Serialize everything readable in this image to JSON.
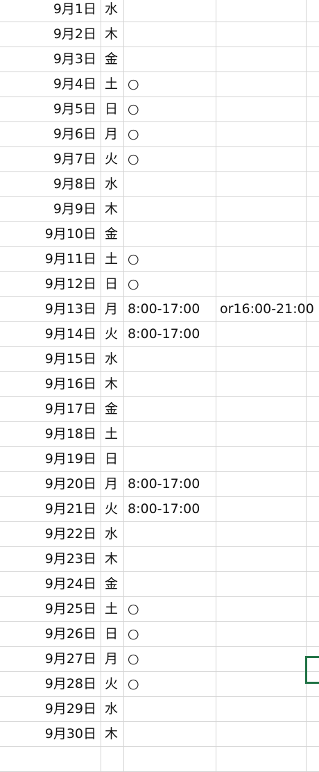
{
  "sheet": {
    "rows": [
      {
        "date": "9月1日",
        "weekday": "水",
        "col_c": "",
        "col_d": ""
      },
      {
        "date": "9月2日",
        "weekday": "木",
        "col_c": "",
        "col_d": ""
      },
      {
        "date": "9月3日",
        "weekday": "金",
        "col_c": "",
        "col_d": ""
      },
      {
        "date": "9月4日",
        "weekday": "土",
        "col_c": "○",
        "col_d": ""
      },
      {
        "date": "9月5日",
        "weekday": "日",
        "col_c": "○",
        "col_d": ""
      },
      {
        "date": "9月6日",
        "weekday": "月",
        "col_c": "○",
        "col_d": ""
      },
      {
        "date": "9月7日",
        "weekday": "火",
        "col_c": "○",
        "col_d": ""
      },
      {
        "date": "9月8日",
        "weekday": "水",
        "col_c": "",
        "col_d": ""
      },
      {
        "date": "9月9日",
        "weekday": "木",
        "col_c": "",
        "col_d": ""
      },
      {
        "date": "9月10日",
        "weekday": "金",
        "col_c": "",
        "col_d": ""
      },
      {
        "date": "9月11日",
        "weekday": "土",
        "col_c": "○",
        "col_d": ""
      },
      {
        "date": "9月12日",
        "weekday": "日",
        "col_c": "○",
        "col_d": ""
      },
      {
        "date": "9月13日",
        "weekday": "月",
        "col_c": "8:00-17:00",
        "col_d": "or16:00-21:00"
      },
      {
        "date": "9月14日",
        "weekday": "火",
        "col_c": "8:00-17:00",
        "col_d": ""
      },
      {
        "date": "9月15日",
        "weekday": "水",
        "col_c": "",
        "col_d": ""
      },
      {
        "date": "9月16日",
        "weekday": "木",
        "col_c": "",
        "col_d": ""
      },
      {
        "date": "9月17日",
        "weekday": "金",
        "col_c": "",
        "col_d": ""
      },
      {
        "date": "9月18日",
        "weekday": "土",
        "col_c": "",
        "col_d": ""
      },
      {
        "date": "9月19日",
        "weekday": "日",
        "col_c": "",
        "col_d": ""
      },
      {
        "date": "9月20日",
        "weekday": "月",
        "col_c": "8:00-17:00",
        "col_d": ""
      },
      {
        "date": "9月21日",
        "weekday": "火",
        "col_c": "8:00-17:00",
        "col_d": ""
      },
      {
        "date": "9月22日",
        "weekday": "水",
        "col_c": "",
        "col_d": ""
      },
      {
        "date": "9月23日",
        "weekday": "木",
        "col_c": "",
        "col_d": ""
      },
      {
        "date": "9月24日",
        "weekday": "金",
        "col_c": "",
        "col_d": ""
      },
      {
        "date": "9月25日",
        "weekday": "土",
        "col_c": "○",
        "col_d": ""
      },
      {
        "date": "9月26日",
        "weekday": "日",
        "col_c": "○",
        "col_d": ""
      },
      {
        "date": "9月27日",
        "weekday": "月",
        "col_c": "○",
        "col_d": ""
      },
      {
        "date": "9月28日",
        "weekday": "火",
        "col_c": "○",
        "col_d": ""
      },
      {
        "date": "9月29日",
        "weekday": "水",
        "col_c": "",
        "col_d": ""
      },
      {
        "date": "9月30日",
        "weekday": "木",
        "col_c": "",
        "col_d": ""
      }
    ]
  },
  "colors": {
    "gridline": "#d4d4d4",
    "selection_border": "#217346",
    "text": "#111111"
  }
}
